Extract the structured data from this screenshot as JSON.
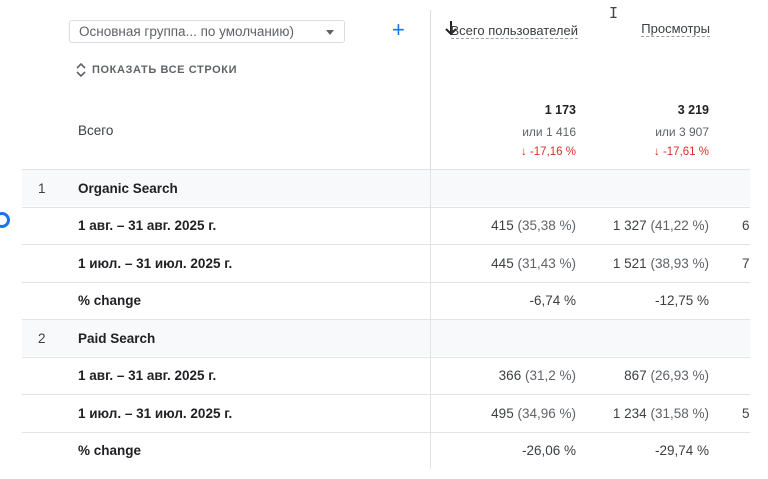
{
  "dimension_selector": {
    "value": "Основная группа... по умолчанию)"
  },
  "add_dimension_label": "+",
  "show_all_rows_label": "ПОКАЗАТЬ ВСЕ СТРОКИ",
  "columns": {
    "users": "Всего пользователей",
    "views": "Просмотры"
  },
  "totals": {
    "label": "Всего",
    "users": {
      "value": "1 173",
      "compare": "или 1 416",
      "delta": "↓ -17,16 %"
    },
    "views": {
      "value": "3 219",
      "compare": "или 3 907",
      "delta": "↓ -17,61 %"
    }
  },
  "rows": [
    {
      "type": "group",
      "index": "1",
      "label": "Organic Search",
      "users": "",
      "users_pct": "",
      "views": "",
      "views_pct": "",
      "extra": ""
    },
    {
      "type": "period",
      "index": "",
      "label": "1 авг. – 31 авг. 2025 г.",
      "users": "415",
      "users_pct": "(35,38 %)",
      "views": "1 327",
      "views_pct": "(41,22 %)",
      "extra": "6"
    },
    {
      "type": "period",
      "index": "",
      "label": "1 июл. – 31 июл. 2025 г.",
      "users": "445",
      "users_pct": "(31,43 %)",
      "views": "1 521",
      "views_pct": "(38,93 %)",
      "extra": "7"
    },
    {
      "type": "change",
      "index": "",
      "label": "% change",
      "users": "-6,74 %",
      "users_pct": "",
      "views": "-12,75 %",
      "views_pct": "",
      "extra": ""
    },
    {
      "type": "group",
      "index": "2",
      "label": "Paid Search",
      "users": "",
      "users_pct": "",
      "views": "",
      "views_pct": "",
      "extra": ""
    },
    {
      "type": "period",
      "index": "",
      "label": "1 авг. – 31 авг. 2025 г.",
      "users": "366",
      "users_pct": "(31,2 %)",
      "views": "867",
      "views_pct": "(26,93 %)",
      "extra": ""
    },
    {
      "type": "period",
      "index": "",
      "label": "1 июл. – 31 июл. 2025 г.",
      "users": "495",
      "users_pct": "(34,96 %)",
      "views": "1 234",
      "views_pct": "(31,58 %)",
      "extra": "5"
    },
    {
      "type": "change",
      "index": "",
      "label": "% change",
      "users": "-26,06 %",
      "users_pct": "",
      "views": "-29,74 %",
      "views_pct": "",
      "extra": ""
    }
  ],
  "icons": {
    "sort": "arrow-down-icon",
    "expand": "unfold-icon",
    "dropdown": "caret-down-icon"
  },
  "colors": {
    "accent": "#1a73e8",
    "negative": "#d93025",
    "group_bg": "#f8f9fa"
  }
}
